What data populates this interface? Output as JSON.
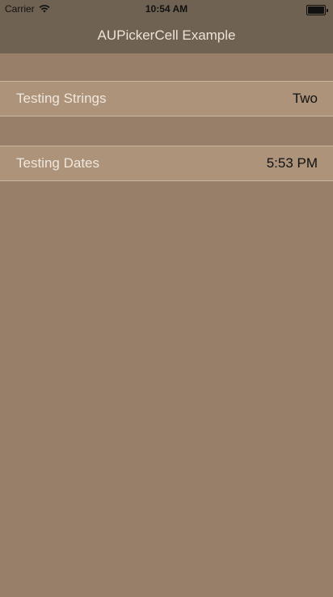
{
  "status_bar": {
    "carrier": "Carrier",
    "time": "10:54 AM",
    "wifi_icon": "wifi-icon",
    "battery_icon": "battery-icon"
  },
  "nav_bar": {
    "title": "AUPickerCell Example"
  },
  "cells": [
    {
      "label": "Testing Strings",
      "value": "Two"
    },
    {
      "label": "Testing Dates",
      "value": "5:53 PM"
    }
  ],
  "colors": {
    "background": "#977f69",
    "bar": "#6f6252",
    "cell": "#ad937a",
    "separator": "#c9b7a4"
  }
}
